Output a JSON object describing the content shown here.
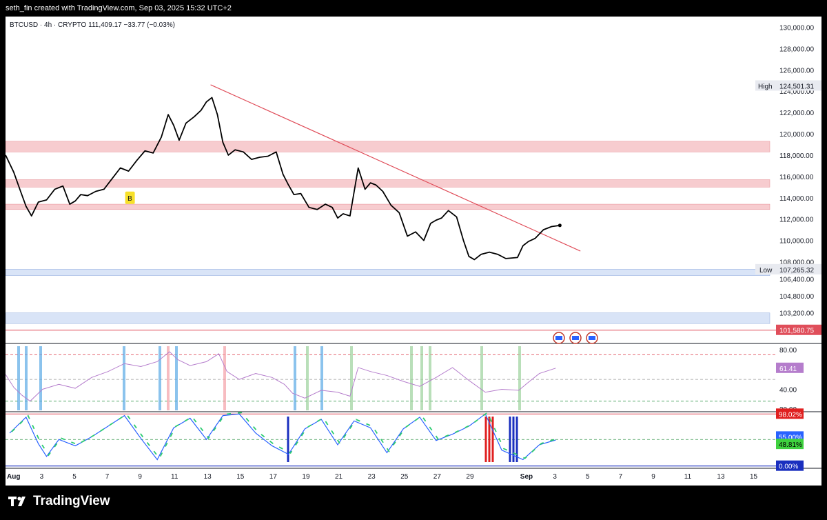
{
  "header": {
    "attribution": "seth_fin created with TradingView.com, Sep 03, 2025 15:32 UTC+2"
  },
  "legend": {
    "symbol": "BTCUSD",
    "interval": "4h",
    "exchange": "CRYPTO",
    "last_price": "111,409.17",
    "change": "−33.77 (−0.03%)"
  },
  "brand": {
    "name": "TradingView",
    "icon": "tradingview-logo-icon"
  },
  "colors": {
    "price_line": "#000000",
    "trendline": "#e04e5a",
    "rsi_line": "#b57dcc",
    "stoch_fast": "#2962ff",
    "resistance_zone": "#f4b6ba",
    "support_zone": "#c9d8f3",
    "buy_badge": "#f7e02a"
  },
  "chart_data": [
    {
      "type": "line",
      "title": "",
      "xlabel": "",
      "ylabel": "",
      "ylim": [
        100400,
        131000
      ],
      "x_tick_labels": [
        "Aug",
        "3",
        "5",
        "7",
        "9",
        "11",
        "13",
        "15",
        "17",
        "19",
        "21",
        "23",
        "25",
        "27",
        "29",
        "Sep",
        "3",
        "5",
        "7",
        "9",
        "11",
        "13",
        "15"
      ],
      "y_tick_labels": [
        "130,000.00",
        "128,000.00",
        "126,000.00",
        "124,000.00",
        "122,000.00",
        "120,000.00",
        "118,000.00",
        "116,000.00",
        "114,000.00",
        "112,000.00",
        "110,000.00",
        "108,000.00",
        "106,400.00",
        "104,800.00",
        "103,200.00"
      ],
      "y_tick_values": [
        130000,
        128000,
        126000,
        124000,
        122000,
        120000,
        118000,
        116000,
        114000,
        112000,
        110000,
        108000,
        106400,
        104800,
        103200
      ],
      "series": [
        {
          "x": [
            "Aug 1",
            "Aug 1",
            "Aug 2",
            "Aug 2",
            "Aug 2",
            "Aug 3",
            "Aug 3",
            "Aug 4",
            "Aug 4",
            "Aug 5",
            "Aug 5",
            "Aug 5",
            "Aug 6",
            "Aug 6",
            "Aug 7",
            "Aug 7",
            "Aug 8",
            "Aug 8",
            "Aug 9",
            "Aug 9",
            "Aug 10",
            "Aug 10",
            "Aug 11",
            "Aug 11",
            "Aug 11",
            "Aug 12",
            "Aug 12",
            "Aug 13",
            "Aug 13",
            "Aug 13",
            "Aug 14",
            "Aug 14",
            "Aug 14",
            "Aug 15",
            "Aug 15",
            "Aug 16",
            "Aug 16",
            "Aug 17",
            "Aug 17",
            "Aug 18",
            "Aug 18",
            "Aug 18",
            "Aug 19",
            "Aug 19",
            "Aug 20",
            "Aug 20",
            "Aug 21",
            "Aug 21",
            "Aug 21",
            "Aug 22",
            "Aug 22",
            "Aug 23",
            "Aug 23",
            "Aug 23",
            "Aug 24",
            "Aug 24",
            "Aug 25",
            "Aug 25",
            "Aug 26",
            "Aug 26",
            "Aug 27",
            "Aug 27",
            "Aug 27",
            "Aug 28",
            "Aug 28",
            "Aug 29",
            "Aug 29",
            "Aug 29",
            "Aug 30",
            "Aug 30",
            "Aug 31",
            "Aug 31",
            "Sep 1",
            "Sep 1",
            "Sep 1",
            "Sep 2",
            "Sep 2",
            "Sep 3",
            "Sep 3"
          ],
          "values": [
            118000,
            116400,
            114600,
            113200,
            112300,
            113600,
            113800,
            114800,
            115100,
            113400,
            113700,
            114300,
            114200,
            114600,
            114800,
            115800,
            116800,
            116500,
            117500,
            118400,
            118200,
            119700,
            121800,
            120800,
            119400,
            121000,
            121600,
            122200,
            123000,
            123400,
            121800,
            119200,
            118000,
            118500,
            118300,
            117600,
            117800,
            117900,
            118300,
            116200,
            115200,
            114300,
            114400,
            113100,
            112900,
            113400,
            113100,
            112100,
            112500,
            112300,
            116800,
            114800,
            115400,
            115200,
            114600,
            113300,
            112600,
            110400,
            110800,
            110000,
            111600,
            111900,
            112100,
            112800,
            112200,
            110000,
            108500,
            108200,
            108700,
            108900,
            108700,
            108300,
            108400,
            109500,
            109900,
            110200,
            111000,
            111300,
            111409
          ]
        }
      ],
      "trendline": {
        "from": {
          "x": "Aug 13",
          "y": 124600
        },
        "to": {
          "x": "Sep 4",
          "y": 109000
        }
      },
      "zones": [
        {
          "kind": "resistance",
          "y": [
            118300,
            119300
          ]
        },
        {
          "kind": "resistance",
          "y": [
            115000,
            115700
          ]
        },
        {
          "kind": "resistance",
          "y": [
            112900,
            113400
          ]
        },
        {
          "kind": "support",
          "y": [
            106700,
            107300
          ]
        },
        {
          "kind": "support",
          "y": [
            102200,
            103200
          ]
        }
      ],
      "markers": [
        {
          "label": "B",
          "x": "Aug 8",
          "y": 114000
        }
      ],
      "price_labels": [
        {
          "label": "High",
          "value": "124,501.31",
          "y": 124501.31
        },
        {
          "label": "Low",
          "value": "107,265.32",
          "y": 107265.32
        },
        {
          "label": "",
          "value": "101,580.75",
          "y": 101580.75
        }
      ]
    },
    {
      "type": "line",
      "title": "",
      "ylim": [
        18,
        85
      ],
      "y_tick_labels": [
        "80.00",
        "40.00",
        "20.00"
      ],
      "y_tick_values": [
        80,
        40,
        20
      ],
      "current_label": "61.41",
      "series": [
        {
          "x": [
            "Aug 1",
            "Aug 1",
            "Aug 2",
            "Aug 2",
            "Aug 3",
            "Aug 4",
            "Aug 5",
            "Aug 6",
            "Aug 7",
            "Aug 8",
            "Aug 9",
            "Aug 10",
            "Aug 11",
            "Aug 11",
            "Aug 12",
            "Aug 13",
            "Aug 14",
            "Aug 14",
            "Aug 15",
            "Aug 16",
            "Aug 17",
            "Aug 18",
            "Aug 18",
            "Aug 19",
            "Aug 20",
            "Aug 21",
            "Aug 22",
            "Aug 22",
            "Aug 23",
            "Aug 24",
            "Aug 25",
            "Aug 26",
            "Aug 27",
            "Aug 28",
            "Aug 29",
            "Aug 30",
            "Aug 31",
            "Sep 1",
            "Sep 1",
            "Sep 2",
            "Sep 3"
          ],
          "values": [
            55,
            42,
            34,
            28,
            40,
            45,
            41,
            52,
            58,
            66,
            63,
            68,
            78,
            70,
            64,
            68,
            76,
            58,
            50,
            56,
            52,
            45,
            36,
            31,
            39,
            37,
            33,
            62,
            58,
            54,
            48,
            43,
            52,
            62,
            49,
            37,
            40,
            39,
            46,
            56,
            61.41
          ]
        }
      ]
    },
    {
      "type": "line",
      "title": "",
      "ylim": [
        -3,
        101
      ],
      "current_labels": [
        "98.02%",
        "55.00%",
        "48.81%",
        "0.00%"
      ],
      "levels": [
        98.02,
        55.0,
        48.81,
        0.0
      ],
      "series": [
        {
          "x": [
            "Aug 1",
            "Aug 2",
            "Aug 3",
            "Aug 3",
            "Aug 4",
            "Aug 5",
            "Aug 6",
            "Aug 7",
            "Aug 8",
            "Aug 9",
            "Aug 10",
            "Aug 11",
            "Aug 12",
            "Aug 13",
            "Aug 14",
            "Aug 15",
            "Aug 16",
            "Aug 17",
            "Aug 18",
            "Aug 19",
            "Aug 20",
            "Aug 21",
            "Aug 22",
            "Aug 23",
            "Aug 24",
            "Aug 25",
            "Aug 26",
            "Aug 27",
            "Aug 28",
            "Aug 29",
            "Aug 30",
            "Aug 31",
            "Sep 1",
            "Sep 2",
            "Sep 3"
          ],
          "values": [
            62,
            92,
            42,
            18,
            50,
            38,
            55,
            75,
            95,
            52,
            12,
            72,
            90,
            50,
            95,
            98,
            62,
            38,
            22,
            70,
            88,
            40,
            85,
            72,
            25,
            70,
            92,
            48,
            60,
            75,
            98,
            30,
            12,
            40,
            49
          ]
        }
      ]
    }
  ]
}
